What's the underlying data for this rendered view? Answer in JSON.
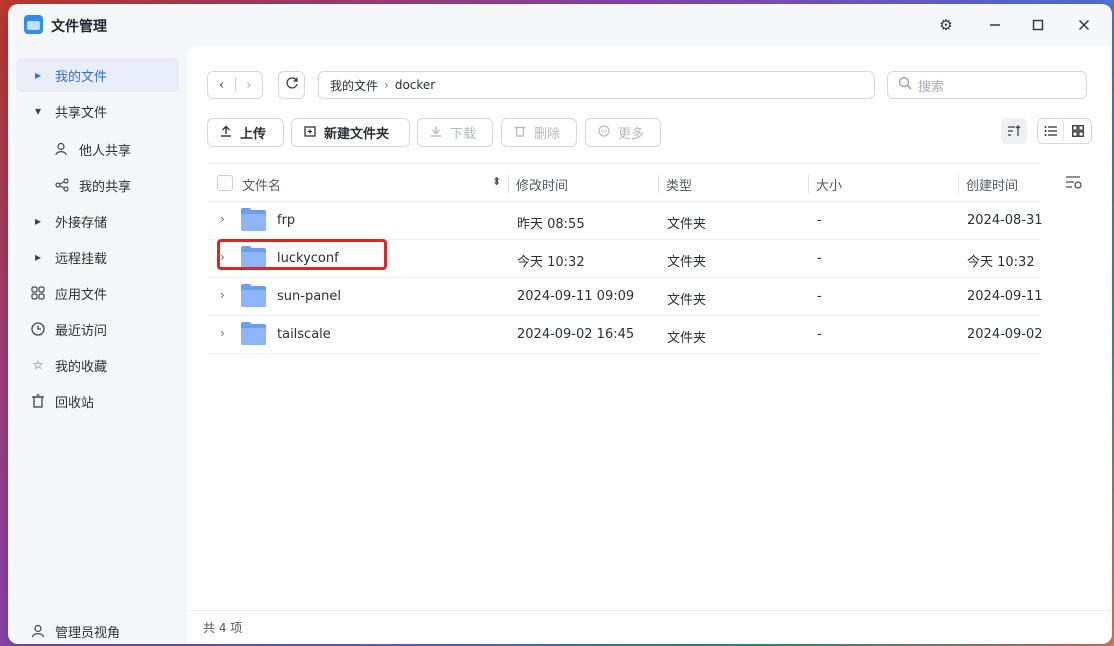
{
  "app": {
    "title": "文件管理"
  },
  "sidebar": {
    "items": [
      {
        "label": "我的文件",
        "icon": "caret-right-icon"
      },
      {
        "label": "共享文件",
        "icon": "caret-down-icon"
      },
      {
        "label": "他人共享",
        "icon": "users-icon"
      },
      {
        "label": "我的共享",
        "icon": "share-icon"
      },
      {
        "label": "外接存储",
        "icon": "caret-right-icon"
      },
      {
        "label": "远程挂载",
        "icon": "caret-right-icon"
      },
      {
        "label": "应用文件",
        "icon": "apps-grid-icon"
      },
      {
        "label": "最近访问",
        "icon": "clock-icon"
      },
      {
        "label": "我的收藏",
        "icon": "star-icon"
      },
      {
        "label": "回收站",
        "icon": "trash-icon"
      }
    ],
    "admin_view": "管理员视角"
  },
  "path": {
    "root": "我的文件",
    "current": "docker"
  },
  "search": {
    "placeholder": "搜索"
  },
  "toolbar": {
    "upload": "上传",
    "new_folder": "新建文件夹",
    "download": "下载",
    "delete": "删除",
    "more": "更多"
  },
  "table": {
    "headers": {
      "name": "文件名",
      "modified": "修改时间",
      "type": "类型",
      "size": "大小",
      "created": "创建时间"
    },
    "rows": [
      {
        "name": "frp",
        "modified": "昨天 08:55",
        "type": "文件夹",
        "size": "-",
        "created": "2024-08-31"
      },
      {
        "name": "luckyconf",
        "modified": "今天 10:32",
        "type": "文件夹",
        "size": "-",
        "created": "今天 10:32"
      },
      {
        "name": "sun-panel",
        "modified": "2024-09-11 09:09",
        "type": "文件夹",
        "size": "-",
        "created": "2024-09-11"
      },
      {
        "name": "tailscale",
        "modified": "2024-09-02 16:45",
        "type": "文件夹",
        "size": "-",
        "created": "2024-09-02"
      }
    ]
  },
  "footer": {
    "count": "共 4 项"
  }
}
